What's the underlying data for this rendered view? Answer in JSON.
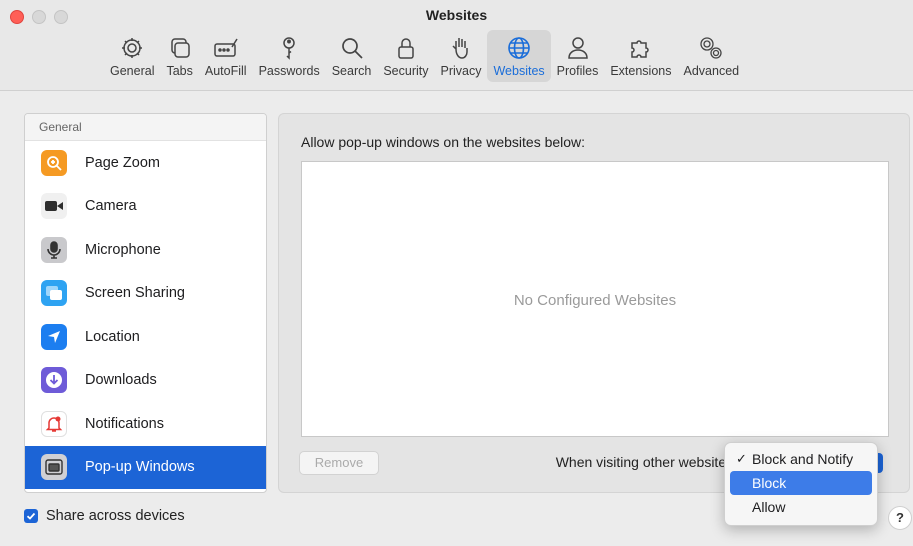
{
  "window": {
    "title": "Websites"
  },
  "toolbar": {
    "items": [
      {
        "label": "General",
        "icon": "gear-icon"
      },
      {
        "label": "Tabs",
        "icon": "tabs-icon"
      },
      {
        "label": "AutoFill",
        "icon": "autofill-icon"
      },
      {
        "label": "Passwords",
        "icon": "key-icon"
      },
      {
        "label": "Search",
        "icon": "search-icon"
      },
      {
        "label": "Security",
        "icon": "lock-icon"
      },
      {
        "label": "Privacy",
        "icon": "hand-icon"
      },
      {
        "label": "Websites",
        "icon": "globe-icon",
        "active": true
      },
      {
        "label": "Profiles",
        "icon": "person-icon"
      },
      {
        "label": "Extensions",
        "icon": "puzzle-icon"
      },
      {
        "label": "Advanced",
        "icon": "gears-icon"
      }
    ],
    "active_color": "#1a6dd9"
  },
  "sidebar": {
    "header": "General",
    "items": [
      {
        "label": "Page Zoom",
        "icon": "zoom-icon",
        "color": "#f59a23"
      },
      {
        "label": "Camera",
        "icon": "camera-icon",
        "color": "#3a3a3a"
      },
      {
        "label": "Microphone",
        "icon": "microphone-icon",
        "color": "#8e8e93"
      },
      {
        "label": "Screen Sharing",
        "icon": "screen-sharing-icon",
        "color": "#2ea3f2"
      },
      {
        "label": "Location",
        "icon": "location-icon",
        "color": "#1c7ef0"
      },
      {
        "label": "Downloads",
        "icon": "downloads-icon",
        "color": "#6e5bd8"
      },
      {
        "label": "Notifications",
        "icon": "notifications-icon",
        "color": "#e53935"
      },
      {
        "label": "Pop-up Windows",
        "icon": "popup-windows-icon",
        "color": "#8e8e93",
        "selected": true
      }
    ]
  },
  "main": {
    "heading": "Allow pop-up windows on the websites below:",
    "empty_text": "No Configured Websites",
    "remove_label": "Remove",
    "visiting_label": "When visiting other websites:"
  },
  "menu": {
    "options": [
      {
        "label": "Block and Notify",
        "checked": true
      },
      {
        "label": "Block",
        "highlighted": true
      },
      {
        "label": "Allow"
      }
    ],
    "check_glyph": "✓"
  },
  "footer": {
    "share_label": "Share across devices",
    "share_checked": true,
    "help_label": "?"
  }
}
